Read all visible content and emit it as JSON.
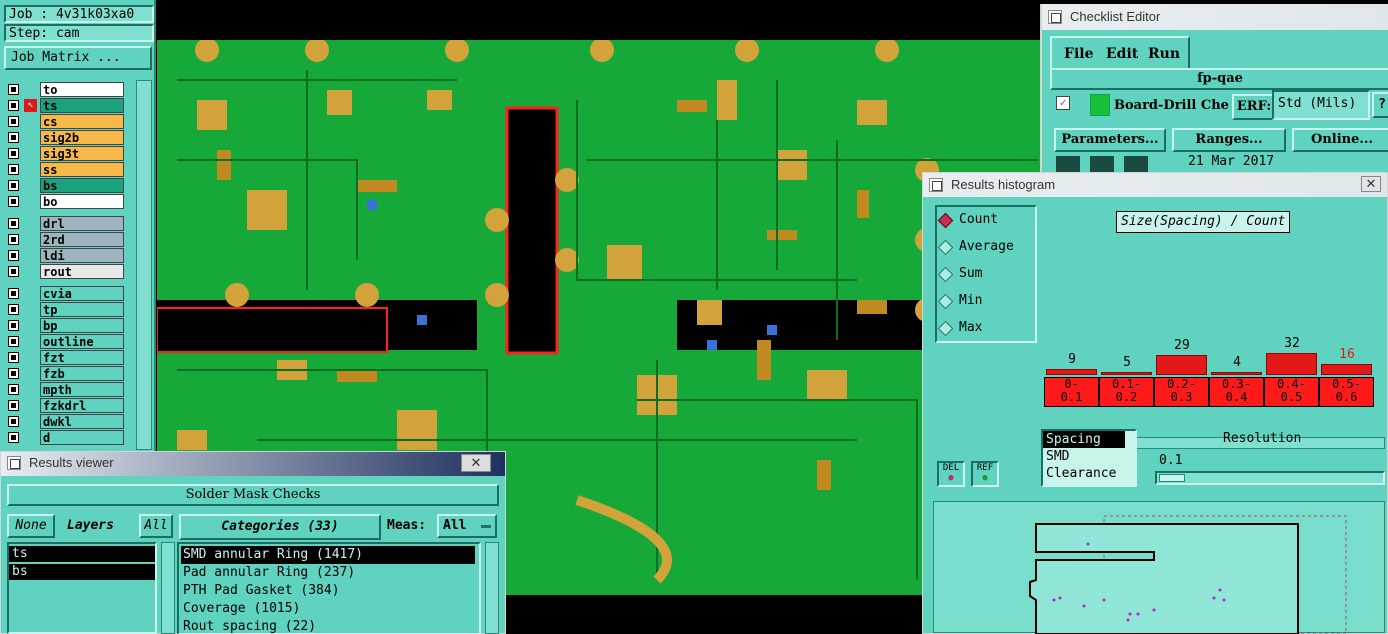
{
  "job": {
    "job_line": "Job : 4v31k03xa0",
    "step_line": "Step: cam",
    "matrix_button": "Job Matrix ..."
  },
  "layers": [
    {
      "name": "to",
      "color": "#ffffff"
    },
    {
      "name": "ts",
      "color": "#1aa37e",
      "selected": true
    },
    {
      "name": "cs",
      "color": "#f7b84a"
    },
    {
      "name": "sig2b",
      "color": "#f7b84a"
    },
    {
      "name": "sig3t",
      "color": "#f7b84a"
    },
    {
      "name": "ss",
      "color": "#f7b84a"
    },
    {
      "name": "bs",
      "color": "#1aa37e"
    },
    {
      "name": "bo",
      "color": "#ffffff"
    },
    {
      "name": "drl",
      "color": "#9fb4bd"
    },
    {
      "name": "2rd",
      "color": "#9fb4bd"
    },
    {
      "name": "ldi",
      "color": "#9fb4bd"
    },
    {
      "name": "rout",
      "color": "#e8e8e8"
    },
    {
      "name": "cvia",
      "color": "#5fd3bf"
    },
    {
      "name": "tp",
      "color": "#5fd3bf"
    },
    {
      "name": "bp",
      "color": "#5fd3bf"
    },
    {
      "name": "outline",
      "color": "#5fd3bf"
    },
    {
      "name": "fzt",
      "color": "#5fd3bf"
    },
    {
      "name": "fzb",
      "color": "#5fd3bf"
    },
    {
      "name": "mpth",
      "color": "#5fd3bf"
    },
    {
      "name": "fzkdrl",
      "color": "#5fd3bf"
    },
    {
      "name": "dwkl",
      "color": "#5fd3bf"
    },
    {
      "name": "d",
      "color": "#5fd3bf"
    }
  ],
  "checklist": {
    "title": "Checklist Editor",
    "menu": [
      "File",
      "Edit",
      "Run"
    ],
    "name": "fp-qae",
    "action_label": "Board-Drill Che",
    "erf_button": "ERF:",
    "erf_value": "Std (Mils)",
    "buttons": [
      "Parameters...",
      "Ranges...",
      "Online..."
    ],
    "date": "21 Mar 2017"
  },
  "histogram": {
    "title": "Results histogram",
    "modes": [
      "Count",
      "Average",
      "Sum",
      "Min",
      "Max"
    ],
    "selected_mode": "Count",
    "chart_title": "Size(Spacing) / Count",
    "del_label": "DEL",
    "ref_label": "REF",
    "measures": [
      "Spacing",
      "SMD",
      "Clearance"
    ],
    "resolution_label": "Resolution",
    "resolution_value": "0.1"
  },
  "chart_data": {
    "type": "bar",
    "title": "Size(Spacing) / Count",
    "categories": [
      "0-\n0.1",
      "0.1-\n0.2",
      "0.2-\n0.3",
      "0.3-\n0.4",
      "0.4-\n0.5",
      "0.5-\n0.6"
    ],
    "values": [
      9,
      5,
      29,
      4,
      32,
      16
    ],
    "highlight_index": 5,
    "bar_color": "#e41818"
  },
  "results_viewer": {
    "title": "Results viewer",
    "heading": "Solder Mask Checks",
    "none_button": "None",
    "layers_label": "Layers",
    "all_button": "All",
    "layers": [
      "ts",
      "bs"
    ],
    "categories_label": "Categories (33)",
    "meas_label": "Meas:",
    "meas_value": "All",
    "categories": [
      "SMD annular Ring (1417)",
      "Pad annular Ring (237)",
      "PTH Pad Gasket (384)",
      "Coverage (1015)",
      "Rout spacing (22)"
    ]
  }
}
